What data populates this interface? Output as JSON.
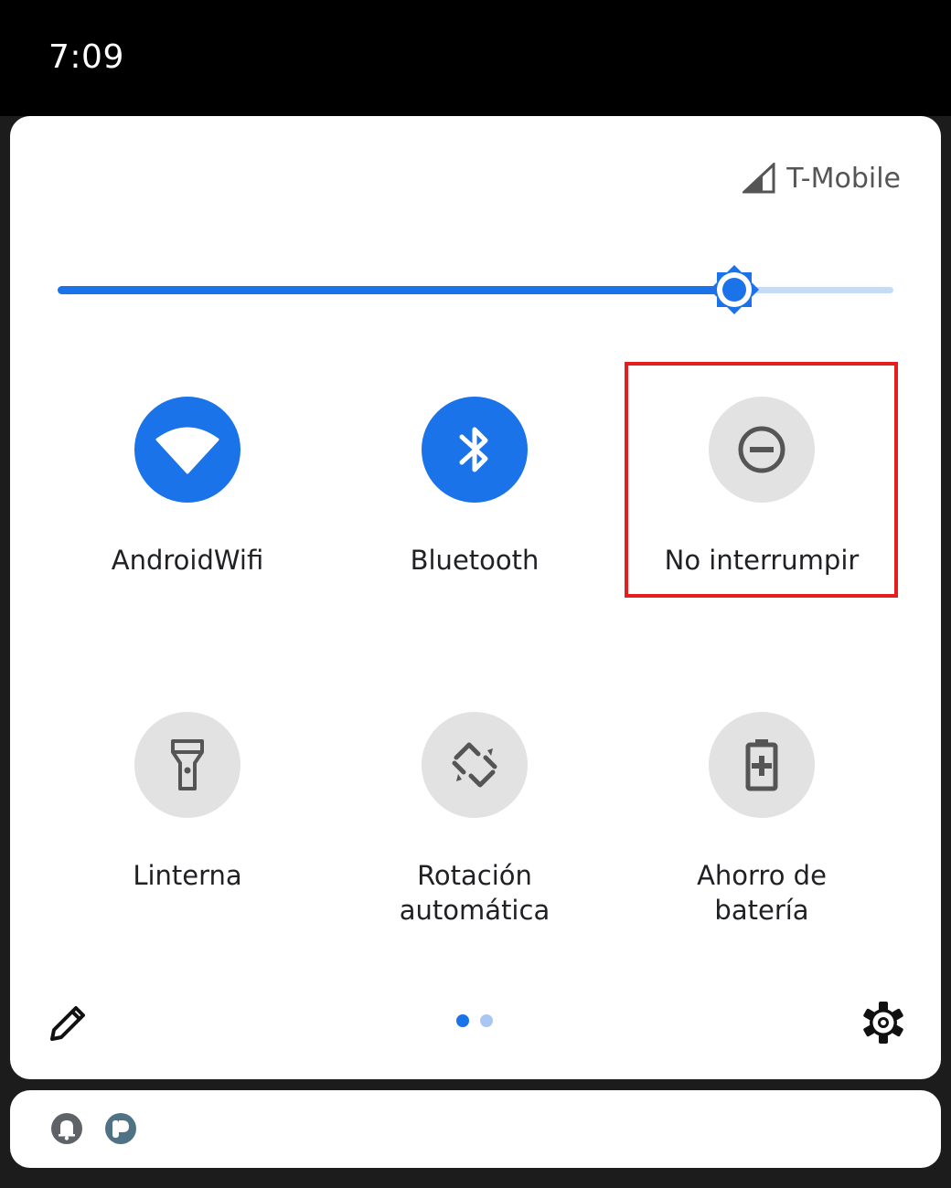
{
  "status_bar": {
    "time": "7:09"
  },
  "header": {
    "carrier": "T-Mobile",
    "signal_icon": "cell-signal-icon"
  },
  "brightness": {
    "level_percent": 81,
    "icon": "brightness-icon"
  },
  "tiles": [
    {
      "label": "AndroidWifi",
      "icon": "wifi-icon",
      "state": "on"
    },
    {
      "label": "Bluetooth",
      "icon": "bluetooth-icon",
      "state": "on"
    },
    {
      "label": "No interrumpir",
      "icon": "do-not-disturb-icon",
      "state": "off"
    },
    {
      "label": "Linterna",
      "icon": "flashlight-icon",
      "state": "off"
    },
    {
      "label_line1": "Rotación",
      "label_line2": "automática",
      "icon": "auto-rotate-icon",
      "state": "off"
    },
    {
      "label": "Ahorro de batería",
      "icon": "battery-saver-icon",
      "state": "off"
    }
  ],
  "footer": {
    "edit_icon": "pencil-icon",
    "settings_icon": "gear-icon",
    "page_count": 2,
    "current_page": 1
  },
  "colors": {
    "accent": "#1a73e8",
    "tile_off": "#e2e2e2",
    "highlight": "#e41e1e"
  },
  "notifications": {
    "icons": [
      "bell-icon",
      "app-notification-icon"
    ]
  }
}
